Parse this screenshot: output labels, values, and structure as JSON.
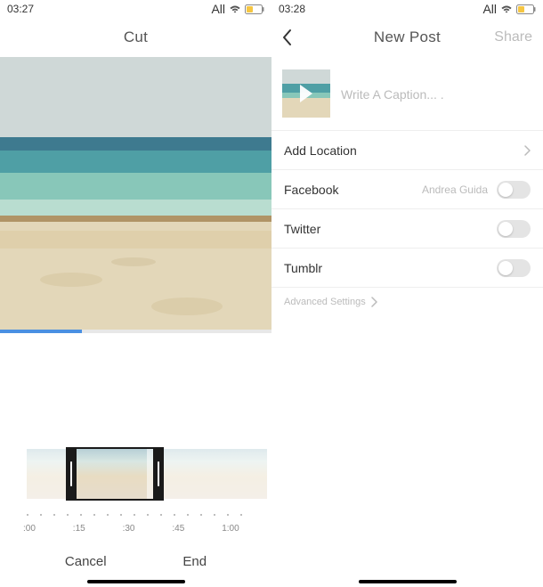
{
  "left": {
    "status_time": "03:27",
    "status_label": "All",
    "nav_title": "Cut",
    "timeline": {
      "labels": [
        ":00",
        ":15",
        ":30",
        ":45",
        "1:00"
      ]
    },
    "cancel_label": "Cancel",
    "end_label": "End"
  },
  "right": {
    "status_time": "03:28",
    "status_label": "All",
    "nav_title": "New Post",
    "share_label": "Share",
    "caption_placeholder": "Write A Caption... .",
    "add_location_label": "Add Location",
    "rows": [
      {
        "label": "Facebook",
        "sub": "Andrea Guida"
      },
      {
        "label": "Twitter",
        "sub": ""
      },
      {
        "label": "Tumblr",
        "sub": ""
      }
    ],
    "advanced_label": "Advanced Settings"
  },
  "icons": {
    "wifi": "wifi-icon",
    "battery": "battery-icon",
    "back": "chevron-left-icon",
    "forward": "chevron-right-icon",
    "play": "play-icon"
  },
  "colors": {
    "accent": "#4a90e2",
    "battery_fill": "#f6c642"
  }
}
